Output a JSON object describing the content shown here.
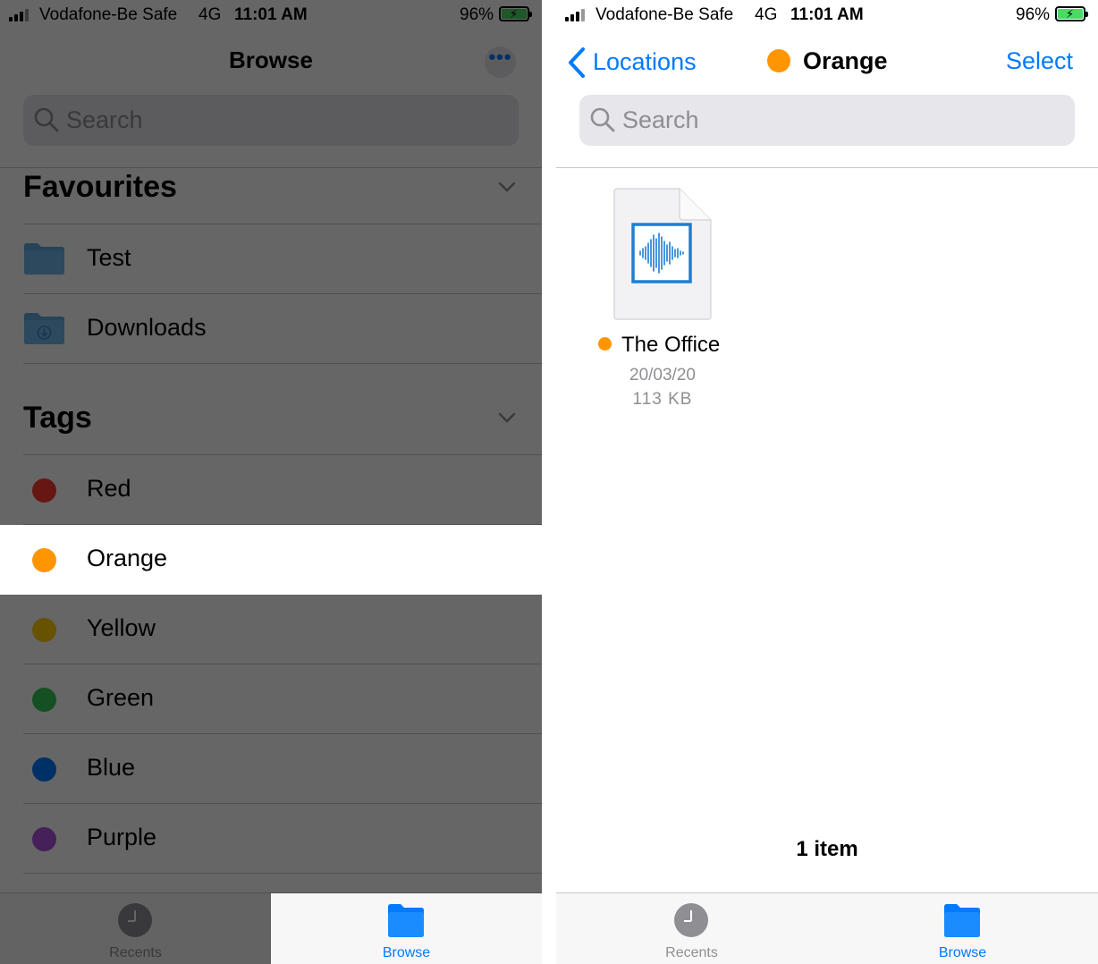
{
  "status_bar": {
    "carrier": "Vodafone-Be Safe",
    "network": "4G",
    "time": "11:01 AM",
    "battery": "96%"
  },
  "left": {
    "nav_title": "Browse",
    "more_label": "•••",
    "search_placeholder": "Search",
    "favourites": {
      "heading": "Favourites",
      "items": [
        {
          "label": "Test",
          "icon": "folder-icon"
        },
        {
          "label": "Downloads",
          "icon": "downloads-folder-icon"
        }
      ]
    },
    "tags": {
      "heading": "Tags",
      "items": [
        {
          "label": "Red",
          "color": "#ff3b30"
        },
        {
          "label": "Orange",
          "color": "#ff9500",
          "selected": true
        },
        {
          "label": "Yellow",
          "color": "#ffcc00"
        },
        {
          "label": "Green",
          "color": "#34c759"
        },
        {
          "label": "Blue",
          "color": "#007aff"
        },
        {
          "label": "Purple",
          "color": "#af52de"
        }
      ]
    },
    "tabs": {
      "recents": "Recents",
      "browse": "Browse",
      "active": "browse"
    }
  },
  "right": {
    "back_label": "Locations",
    "title": "Orange",
    "title_color": "#ff9500",
    "select_label": "Select",
    "search_placeholder": "Search",
    "files": [
      {
        "name": "The Office",
        "date": "20/03/20",
        "size": "113 KB",
        "tag_color": "#ff9500",
        "icon": "audio-waveform-icon"
      }
    ],
    "item_count": "1 item",
    "tabs": {
      "recents": "Recents",
      "browse": "Browse",
      "active": "browse"
    }
  },
  "colors": {
    "accent": "#007aff",
    "dim_overlay": "rgba(0,0,0,0.6)"
  }
}
